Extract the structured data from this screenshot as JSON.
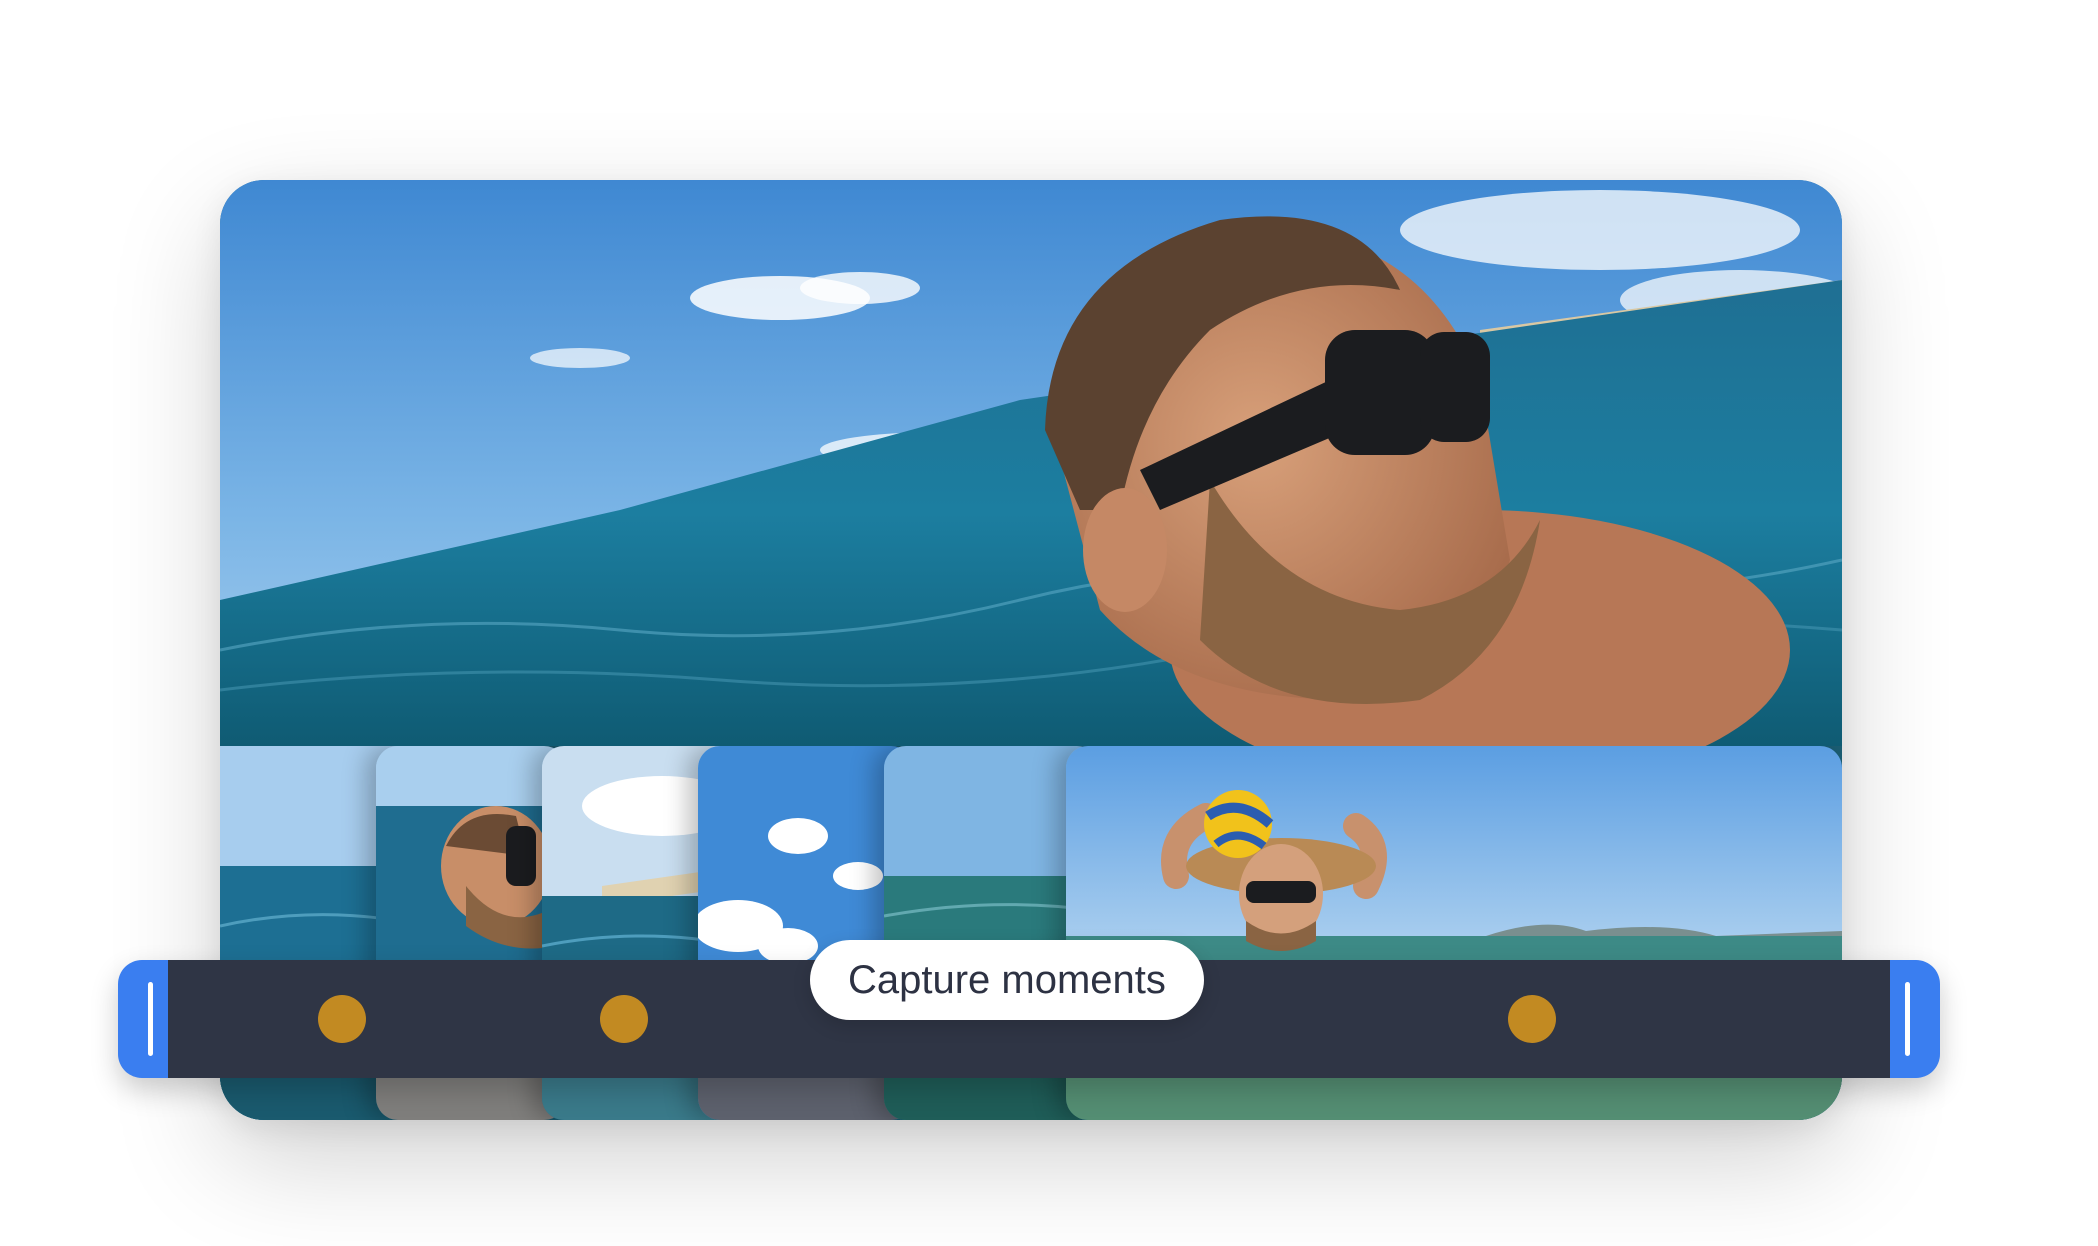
{
  "app": {
    "title": ""
  },
  "preview": {
    "hero_image": "swimmer-sunglasses-sea-photo",
    "thumbnails": [
      "sea-horizon-photo",
      "swimmer-sunglasses-photo",
      "sea-shore-photo",
      "sky-clouds-photo",
      "sea-surface-photo",
      "swimmer-ball-photo"
    ]
  },
  "timeline": {
    "label": "Capture moments",
    "markers": [
      "moment-1",
      "moment-2",
      "moment-3"
    ],
    "track_color": "#2f3545",
    "handle_color": "#3a7ef0",
    "marker_color": "#c28a22"
  }
}
